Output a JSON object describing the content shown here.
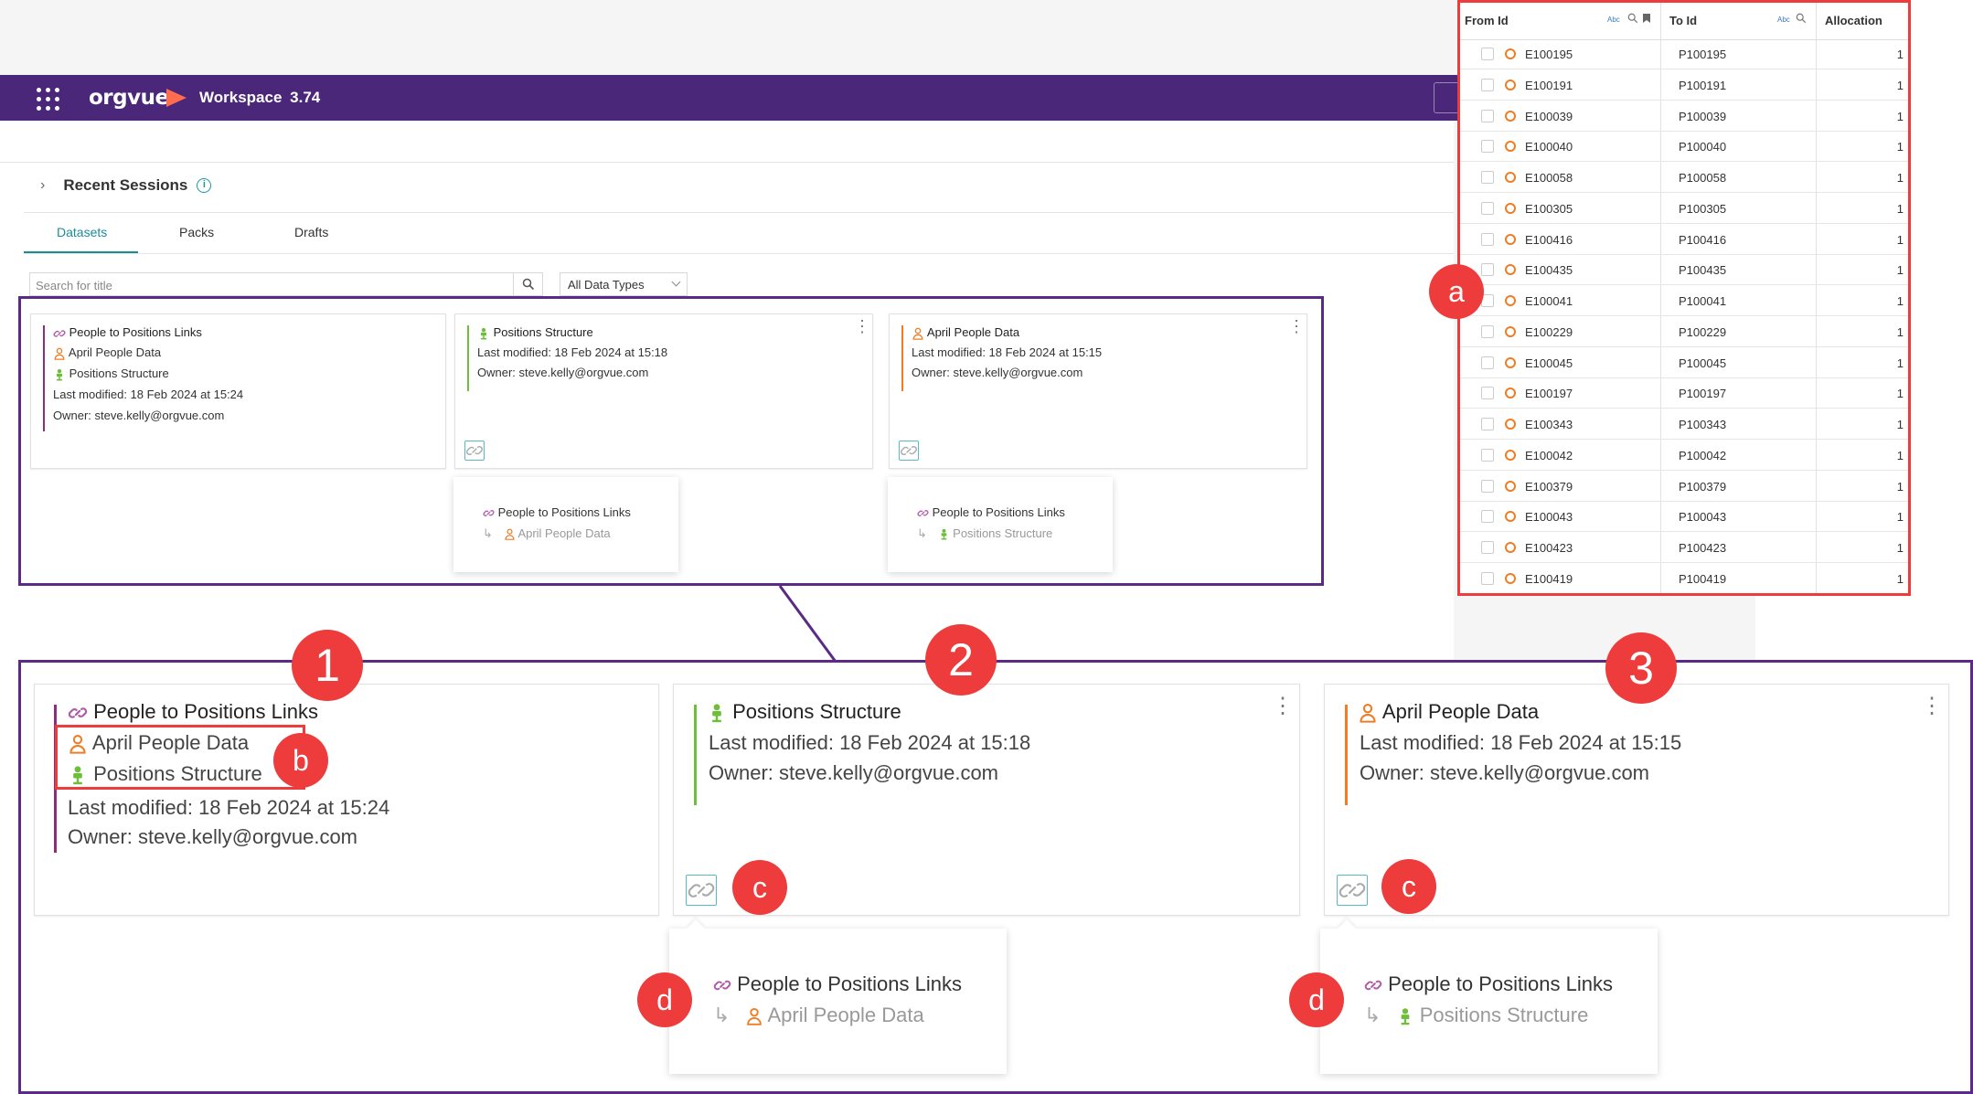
{
  "app": {
    "brand": "orgvue",
    "workspace_label": "Workspace",
    "workspace_version": "3.74",
    "recent_sessions": "Recent Sessions",
    "tabs": [
      {
        "label": "Datasets",
        "active": true
      },
      {
        "label": "Packs",
        "active": false
      },
      {
        "label": "Drafts",
        "active": false
      }
    ],
    "search_placeholder": "Search for title",
    "data_type_filter": "All Data Types"
  },
  "cards": [
    {
      "title": "People to Positions Links",
      "title_icon": "link-icon",
      "sub_items": [
        {
          "label": "April People Data",
          "icon": "person-icon"
        },
        {
          "label": "Positions Structure",
          "icon": "position-icon"
        }
      ],
      "modified": "Last modified: 18 Feb 2024 at 15:24",
      "owner": "Owner: steve.kelly@orgvue.com",
      "accent": "#8b2f7a"
    },
    {
      "title": "Positions Structure",
      "title_icon": "position-icon",
      "modified": "Last modified: 18 Feb 2024 at 15:18",
      "owner": "Owner: steve.kelly@orgvue.com",
      "accent": "#6dbf3a",
      "popup": {
        "title": "People to Positions Links",
        "linked": "April People Data",
        "linked_icon": "person-icon"
      }
    },
    {
      "title": "April People Data",
      "title_icon": "person-icon",
      "modified": "Last modified: 18 Feb 2024 at 15:15",
      "owner": "Owner: steve.kelly@orgvue.com",
      "accent": "#f07d24",
      "popup": {
        "title": "People to Positions Links",
        "linked": "Positions Structure",
        "linked_icon": "position-icon"
      }
    }
  ],
  "callouts": {
    "n1": "1",
    "n2": "2",
    "n3": "3",
    "a": "a",
    "b": "b",
    "c": "c",
    "d": "d"
  },
  "table": {
    "headers": {
      "from": "From Id",
      "to": "To Id",
      "alloc": "Allocation"
    },
    "rows": [
      {
        "from": "E100195",
        "to": "P100195",
        "alloc": "1"
      },
      {
        "from": "E100191",
        "to": "P100191",
        "alloc": "1"
      },
      {
        "from": "E100039",
        "to": "P100039",
        "alloc": "1"
      },
      {
        "from": "E100040",
        "to": "P100040",
        "alloc": "1"
      },
      {
        "from": "E100058",
        "to": "P100058",
        "alloc": "1"
      },
      {
        "from": "E100305",
        "to": "P100305",
        "alloc": "1"
      },
      {
        "from": "E100416",
        "to": "P100416",
        "alloc": "1"
      },
      {
        "from": "E100435",
        "to": "P100435",
        "alloc": "1"
      },
      {
        "from": "E100041",
        "to": "P100041",
        "alloc": "1"
      },
      {
        "from": "E100229",
        "to": "P100229",
        "alloc": "1"
      },
      {
        "from": "E100045",
        "to": "P100045",
        "alloc": "1"
      },
      {
        "from": "E100197",
        "to": "P100197",
        "alloc": "1"
      },
      {
        "from": "E100343",
        "to": "P100343",
        "alloc": "1"
      },
      {
        "from": "E100042",
        "to": "P100042",
        "alloc": "1"
      },
      {
        "from": "E100379",
        "to": "P100379",
        "alloc": "1"
      },
      {
        "from": "E100043",
        "to": "P100043",
        "alloc": "1"
      },
      {
        "from": "E100423",
        "to": "P100423",
        "alloc": "1"
      },
      {
        "from": "E100419",
        "to": "P100419",
        "alloc": "1"
      }
    ]
  },
  "colors": {
    "brand_purple": "#4a2779",
    "teal": "#1a8e97",
    "callout_red": "#ee3b3b",
    "frame_purple": "#5b2a86"
  }
}
